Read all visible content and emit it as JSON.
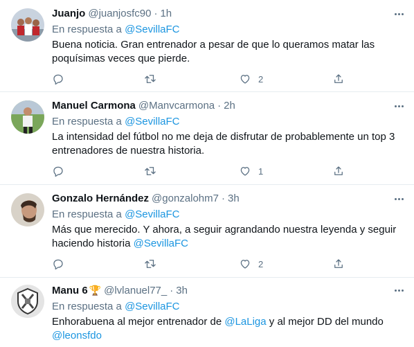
{
  "colors": {
    "accent": "#1b95e0",
    "secondary_text": "#5b7083",
    "border": "#e6ecf0"
  },
  "tweets": [
    {
      "name": "Juanjo",
      "handle": "@juanjosfc90",
      "separator": "·",
      "time": "1h",
      "reply_prefix": "En respuesta a",
      "reply_to": "@SevillaFC",
      "text_lines": [
        "Buena noticia. Gran entrenador a pesar de que lo queramos matar las",
        "poquísimas veces que pierde."
      ],
      "likes": "2"
    },
    {
      "name": "Manuel Carmona",
      "handle": "@Manvcarmona",
      "separator": "·",
      "time": "2h",
      "reply_prefix": "En respuesta a",
      "reply_to": "@SevillaFC",
      "text_lines": [
        "La intensidad del fútbol no me deja de disfrutar de probablemente un top 3",
        "entrenadores de nuestra historia."
      ],
      "likes": "1"
    },
    {
      "name": "Gonzalo Hernández",
      "handle": "@gonzalohm7",
      "separator": "·",
      "time": "3h",
      "reply_prefix": "En respuesta a",
      "reply_to": "@SevillaFC",
      "text_line1": "Más que merecido. Y ahora, a seguir agrandando nuestra leyenda y seguir",
      "text_line2": "haciendo historia",
      "mention": "@SevillaFC",
      "likes": "2"
    },
    {
      "name": "Manu 6",
      "emoji": "🏆",
      "handle": "@lvlanuel77_",
      "separator": "·",
      "time": "3h",
      "reply_prefix": "En respuesta a",
      "reply_to": "@SevillaFC",
      "text_part1": "Enhorabuena al mejor entrenador de",
      "mention1": "@LaLiga",
      "text_part2": "y al mejor DD del mundo",
      "mention2": "@leonsfdo"
    }
  ]
}
